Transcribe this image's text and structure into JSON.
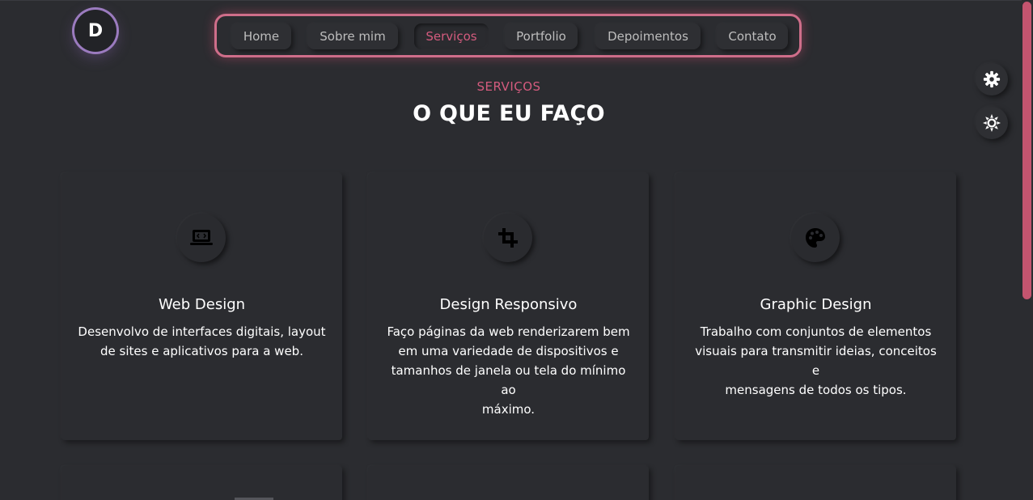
{
  "logo": {
    "letter": "D",
    "accent": "#9b7bbf"
  },
  "nav": {
    "border_color": "#cf6e8a",
    "items": [
      {
        "label": "Home",
        "active": false
      },
      {
        "label": "Sobre mim",
        "active": false
      },
      {
        "label": "Serviços",
        "active": true
      },
      {
        "label": "Portfolio",
        "active": false
      },
      {
        "label": "Depoimentos",
        "active": false
      },
      {
        "label": "Contato",
        "active": false
      }
    ]
  },
  "side_buttons": [
    {
      "icon": "gear-icon"
    },
    {
      "icon": "sun-icon"
    }
  ],
  "section": {
    "kicker": "SERVIÇOS",
    "title": "O QUE EU FAÇO",
    "accent": "#d45b7e"
  },
  "cards": [
    {
      "icon": "laptop-code-icon",
      "title": "Web Design",
      "lines": [
        "Desenvolvo de interfaces digitais, layout",
        "de sites e aplicativos para a web."
      ]
    },
    {
      "icon": "crop-icon",
      "title": "Design Responsivo",
      "lines": [
        "Faço páginas da web renderizarem bem",
        "em uma variedade de dispositivos e",
        "tamanhos de janela ou tela do mínimo ao",
        "máximo."
      ]
    },
    {
      "icon": "palette-icon",
      "title": "Graphic Design",
      "lines": [
        "Trabalho com conjuntos de elementos",
        "visuais para transmitir ideias, conceitos e",
        "mensagens de todos os tipos."
      ]
    }
  ],
  "scrollbar_color": "#c4546f",
  "background": "#2b2c30"
}
